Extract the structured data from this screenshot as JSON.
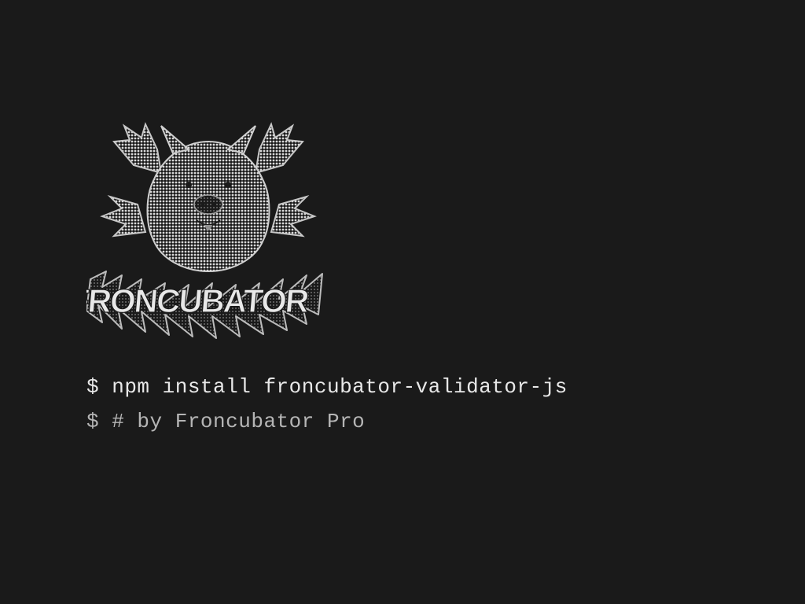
{
  "terminal": {
    "prompt": "$",
    "command_line": "npm install froncubator-validator-js",
    "comment_line": "# by Froncubator Pro"
  },
  "mascot": {
    "name": "froncubator-mascot",
    "text": "FRONCUBATOR"
  }
}
